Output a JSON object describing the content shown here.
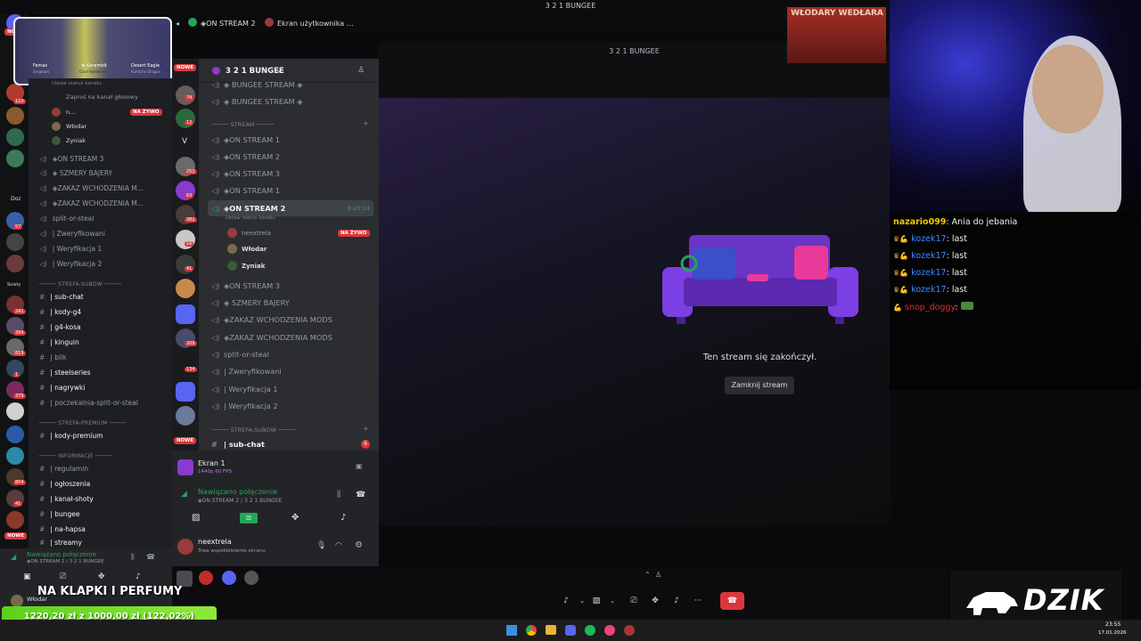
{
  "window": {
    "title": "3 2 1 BUNGEE"
  },
  "stream_tabs": [
    "◈ON STREAM 2",
    "Ekran użytkownika n..."
  ],
  "colors": {
    "accent_green": "#23a55a",
    "danger": "#da373c",
    "discord_bg": "#2b2d31",
    "purple": "#7b3fe4"
  },
  "rail_left": {
    "badges": [
      "110",
      "57",
      "241",
      "394",
      "819",
      "1",
      "379",
      "804",
      "41"
    ],
    "labels": [
      "Doz",
      "Suisty",
      "NOWE",
      "NOWE"
    ]
  },
  "panel1": {
    "status": "Ustaw status kanału",
    "invite": "Zaproś na kanał głosowy",
    "live_badge": "NA ŻYWO",
    "users": [
      "n...",
      "Włodar",
      "Zyniak"
    ],
    "channels": [
      "◈ON STREAM 3",
      "◈ SZMERY BAJERY",
      "◈ZAKAZ WCHODZENIA M...",
      "◈ZAKAZ WCHODZENIA M...",
      "split-or-steal",
      "| Zweryfikowani",
      "| Weryfikacja 1",
      "| Weryfikacja 2"
    ],
    "cat1": "STREFA-SUBOW",
    "sub_channels": [
      "| sub-chat",
      "| kody-g4",
      "| g4-kosa",
      "| kinguin",
      "| blik",
      "| steelseries",
      "| nagrywki",
      "| poczekalnia-split-or-steal"
    ],
    "cat2": "STREFA-PREMIUM",
    "premium_channels": [
      "| kody-premium"
    ],
    "cat3": "INFORMACJE",
    "info_channels": [
      "| regulamin",
      "| ogłoszenia",
      "| kanał-shoty",
      "| bungee",
      "| na-hapsa",
      "| streamy"
    ],
    "voice_status": "Nawiązano połączenie",
    "voice_sub": "◈ON STREAM 2 / 3 2 1 BUNGEE",
    "user": "Włodar"
  },
  "rail2": {
    "badges": [
      "74",
      "12",
      "252",
      "63",
      "382",
      "16",
      "41",
      "209",
      "134"
    ],
    "letter": "V",
    "nowe": "NOWE"
  },
  "server": {
    "name": "3 2 1 BUNGEE",
    "channels_top": [
      "◈ BUNGEE STREAM ◈",
      "◈ BUNGEE STREAM ◈"
    ],
    "cat_stream": "STREAM",
    "stream_channels": [
      "◈ON STREAM 1",
      "◈ON STREAM 2",
      "◈ON STREAM 3",
      "◈ON STREAM 1"
    ],
    "selected_channel": "◈ON STREAM 2",
    "selected_time": "8:20:24",
    "status_hint": "Ustaw status kanału",
    "members": [
      "neextrela",
      "Włodar",
      "Zyniak"
    ],
    "live_badge": "NA ŻYWO",
    "more_channels": [
      "◈ON STREAM 3",
      "◈ SZMERY BAJERY",
      "◈ZAKAZ WCHODZENIA MODS",
      "◈ZAKAZ WCHODZENIA MODS",
      "split-or-steal",
      "| Zweryfikowani",
      "| Weryfikacja 1",
      "| Weryfikacja 2"
    ],
    "cat_sub": "STREFA-SUBOW",
    "sub_chat": "| sub-chat",
    "sub_chat_badge": "6",
    "nowe": "NOWE"
  },
  "voice_panel": {
    "screen_title": "Ekran 1",
    "screen_sub": "1440p 60 FPS",
    "connected": "Nawiązano połączenie",
    "connected_sub": "◈ON STREAM 2 / 3 2 1 BUNGEE",
    "user": "neextrela",
    "user_status": "Trwa współdzielenie ekranu"
  },
  "stream": {
    "header": "3 2 1 BUNGEE",
    "ended": "Ten stream się zakończył.",
    "close": "Zamknij stream"
  },
  "chat": {
    "messages": [
      {
        "user": "nazario099",
        "text": "Ania do jebania",
        "color": "#f0c800",
        "crowns": false
      },
      {
        "user": "kozek17",
        "text": "last",
        "color": "#3b8cff",
        "crowns": true
      },
      {
        "user": "kozek17",
        "text": "last",
        "color": "#3b8cff",
        "crowns": true
      },
      {
        "user": "kozek17",
        "text": "last",
        "color": "#3b8cff",
        "crowns": true
      },
      {
        "user": "kozek17",
        "text": "last",
        "color": "#3b8cff",
        "crowns": true
      },
      {
        "user": "snop_doggy",
        "text": "",
        "color": "#e03030",
        "crowns": false
      }
    ]
  },
  "overlay": {
    "promo": "NA KLAPKI I PERFUMY",
    "donation": "1220,20 zł z 1000,00 zł (122,02%)",
    "donation_progress": 1.2202,
    "brand": "DZIK",
    "poster": "WŁODARY WEDŁARA",
    "weapons": [
      "Famas",
      "★ Karambit",
      "Desert Eagle"
    ],
    "weapon_subs": [
      "Sergeant",
      "Case Hardened",
      "Kumicho Dragon"
    ]
  },
  "taskbar": {
    "time": "23:55",
    "date": "17.01.2026"
  }
}
